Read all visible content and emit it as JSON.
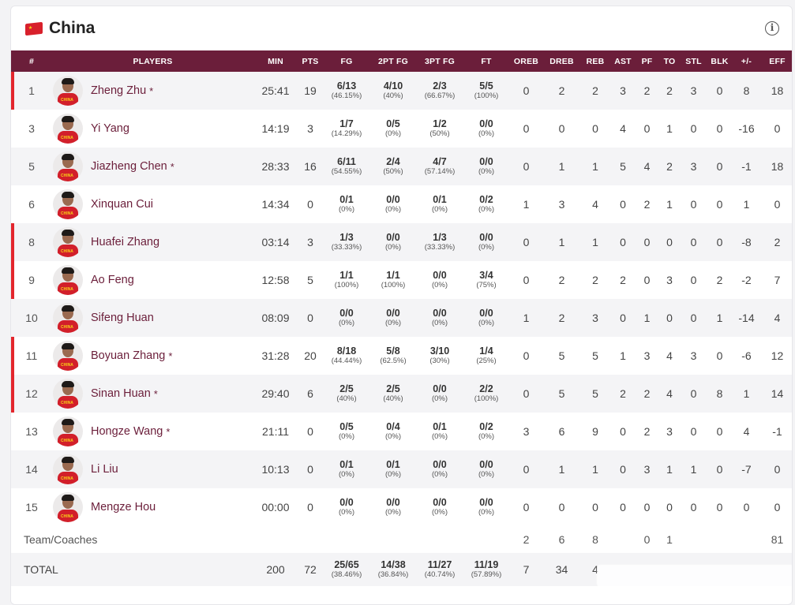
{
  "team": {
    "name": "China",
    "flag_icon": "china-flag-icon",
    "info_icon": "info-icon"
  },
  "colors": {
    "header_bg": "#6b1e3a",
    "starter_marker": "#e3262d",
    "player_name": "#6b1e3a"
  },
  "columns": [
    "#",
    "PLAYERS",
    "MIN",
    "PTS",
    "FG",
    "2PT FG",
    "3PT FG",
    "FT",
    "OREB",
    "DREB",
    "REB",
    "AST",
    "PF",
    "TO",
    "STL",
    "BLK",
    "+/-",
    "EFF"
  ],
  "players": [
    {
      "num": "1",
      "name": "Zheng Zhu",
      "star": "*",
      "starter": true,
      "min": "25:41",
      "pts": "19",
      "fg": "6/13",
      "fg_pct": "(46.15%)",
      "fg2": "4/10",
      "fg2_pct": "(40%)",
      "fg3": "2/3",
      "fg3_pct": "(66.67%)",
      "ft": "5/5",
      "ft_pct": "(100%)",
      "oreb": "0",
      "dreb": "2",
      "reb": "2",
      "ast": "3",
      "pf": "2",
      "to": "2",
      "stl": "3",
      "blk": "0",
      "pm": "8",
      "eff": "18"
    },
    {
      "num": "3",
      "name": "Yi Yang",
      "star": "",
      "starter": false,
      "min": "14:19",
      "pts": "3",
      "fg": "1/7",
      "fg_pct": "(14.29%)",
      "fg2": "0/5",
      "fg2_pct": "(0%)",
      "fg3": "1/2",
      "fg3_pct": "(50%)",
      "ft": "0/0",
      "ft_pct": "(0%)",
      "oreb": "0",
      "dreb": "0",
      "reb": "0",
      "ast": "4",
      "pf": "0",
      "to": "1",
      "stl": "0",
      "blk": "0",
      "pm": "-16",
      "eff": "0"
    },
    {
      "num": "5",
      "name": "Jiazheng Chen",
      "star": "*",
      "starter": false,
      "min": "28:33",
      "pts": "16",
      "fg": "6/11",
      "fg_pct": "(54.55%)",
      "fg2": "2/4",
      "fg2_pct": "(50%)",
      "fg3": "4/7",
      "fg3_pct": "(57.14%)",
      "ft": "0/0",
      "ft_pct": "(0%)",
      "oreb": "0",
      "dreb": "1",
      "reb": "1",
      "ast": "5",
      "pf": "4",
      "to": "2",
      "stl": "3",
      "blk": "0",
      "pm": "-1",
      "eff": "18"
    },
    {
      "num": "6",
      "name": "Xinquan Cui",
      "star": "",
      "starter": false,
      "min": "14:34",
      "pts": "0",
      "fg": "0/1",
      "fg_pct": "(0%)",
      "fg2": "0/0",
      "fg2_pct": "(0%)",
      "fg3": "0/1",
      "fg3_pct": "(0%)",
      "ft": "0/2",
      "ft_pct": "(0%)",
      "oreb": "1",
      "dreb": "3",
      "reb": "4",
      "ast": "0",
      "pf": "2",
      "to": "1",
      "stl": "0",
      "blk": "0",
      "pm": "1",
      "eff": "0"
    },
    {
      "num": "8",
      "name": "Huafei Zhang",
      "star": "",
      "starter": true,
      "min": "03:14",
      "pts": "3",
      "fg": "1/3",
      "fg_pct": "(33.33%)",
      "fg2": "0/0",
      "fg2_pct": "(0%)",
      "fg3": "1/3",
      "fg3_pct": "(33.33%)",
      "ft": "0/0",
      "ft_pct": "(0%)",
      "oreb": "0",
      "dreb": "1",
      "reb": "1",
      "ast": "0",
      "pf": "0",
      "to": "0",
      "stl": "0",
      "blk": "0",
      "pm": "-8",
      "eff": "2"
    },
    {
      "num": "9",
      "name": "Ao Feng",
      "star": "",
      "starter": true,
      "min": "12:58",
      "pts": "5",
      "fg": "1/1",
      "fg_pct": "(100%)",
      "fg2": "1/1",
      "fg2_pct": "(100%)",
      "fg3": "0/0",
      "fg3_pct": "(0%)",
      "ft": "3/4",
      "ft_pct": "(75%)",
      "oreb": "0",
      "dreb": "2",
      "reb": "2",
      "ast": "2",
      "pf": "0",
      "to": "3",
      "stl": "0",
      "blk": "2",
      "pm": "-2",
      "eff": "7"
    },
    {
      "num": "10",
      "name": "Sifeng Huan",
      "star": "",
      "starter": false,
      "min": "08:09",
      "pts": "0",
      "fg": "0/0",
      "fg_pct": "(0%)",
      "fg2": "0/0",
      "fg2_pct": "(0%)",
      "fg3": "0/0",
      "fg3_pct": "(0%)",
      "ft": "0/0",
      "ft_pct": "(0%)",
      "oreb": "1",
      "dreb": "2",
      "reb": "3",
      "ast": "0",
      "pf": "1",
      "to": "0",
      "stl": "0",
      "blk": "1",
      "pm": "-14",
      "eff": "4"
    },
    {
      "num": "11",
      "name": "Boyuan Zhang",
      "star": "*",
      "starter": true,
      "min": "31:28",
      "pts": "20",
      "fg": "8/18",
      "fg_pct": "(44.44%)",
      "fg2": "5/8",
      "fg2_pct": "(62.5%)",
      "fg3": "3/10",
      "fg3_pct": "(30%)",
      "ft": "1/4",
      "ft_pct": "(25%)",
      "oreb": "0",
      "dreb": "5",
      "reb": "5",
      "ast": "1",
      "pf": "3",
      "to": "4",
      "stl": "3",
      "blk": "0",
      "pm": "-6",
      "eff": "12"
    },
    {
      "num": "12",
      "name": "Sinan Huan",
      "star": "*",
      "starter": true,
      "min": "29:40",
      "pts": "6",
      "fg": "2/5",
      "fg_pct": "(40%)",
      "fg2": "2/5",
      "fg2_pct": "(40%)",
      "fg3": "0/0",
      "fg3_pct": "(0%)",
      "ft": "2/2",
      "ft_pct": "(100%)",
      "oreb": "0",
      "dreb": "5",
      "reb": "5",
      "ast": "2",
      "pf": "2",
      "to": "4",
      "stl": "0",
      "blk": "8",
      "pm": "1",
      "eff": "14"
    },
    {
      "num": "13",
      "name": "Hongze Wang",
      "star": "*",
      "starter": false,
      "min": "21:11",
      "pts": "0",
      "fg": "0/5",
      "fg_pct": "(0%)",
      "fg2": "0/4",
      "fg2_pct": "(0%)",
      "fg3": "0/1",
      "fg3_pct": "(0%)",
      "ft": "0/2",
      "ft_pct": "(0%)",
      "oreb": "3",
      "dreb": "6",
      "reb": "9",
      "ast": "0",
      "pf": "2",
      "to": "3",
      "stl": "0",
      "blk": "0",
      "pm": "4",
      "eff": "-1"
    },
    {
      "num": "14",
      "name": "Li Liu",
      "star": "",
      "starter": false,
      "min": "10:13",
      "pts": "0",
      "fg": "0/1",
      "fg_pct": "(0%)",
      "fg2": "0/1",
      "fg2_pct": "(0%)",
      "fg3": "0/0",
      "fg3_pct": "(0%)",
      "ft": "0/0",
      "ft_pct": "(0%)",
      "oreb": "0",
      "dreb": "1",
      "reb": "1",
      "ast": "0",
      "pf": "3",
      "to": "1",
      "stl": "1",
      "blk": "0",
      "pm": "-7",
      "eff": "0"
    },
    {
      "num": "15",
      "name": "Mengze Hou",
      "star": "",
      "starter": false,
      "min": "00:00",
      "pts": "0",
      "fg": "0/0",
      "fg_pct": "(0%)",
      "fg2": "0/0",
      "fg2_pct": "(0%)",
      "fg3": "0/0",
      "fg3_pct": "(0%)",
      "ft": "0/0",
      "ft_pct": "(0%)",
      "oreb": "0",
      "dreb": "0",
      "reb": "0",
      "ast": "0",
      "pf": "0",
      "to": "0",
      "stl": "0",
      "blk": "0",
      "pm": "0",
      "eff": "0"
    }
  ],
  "team_row": {
    "label": "Team/Coaches",
    "oreb": "2",
    "dreb": "6",
    "reb": "8",
    "pf": "0",
    "to": "1",
    "eff": "81"
  },
  "total_row": {
    "label": "TOTAL",
    "min": "200",
    "pts": "72",
    "fg": "25/65",
    "fg_pct": "(38.46%)",
    "fg2": "14/38",
    "fg2_pct": "(36.84%)",
    "fg3": "11/27",
    "fg3_pct": "(40.74%)",
    "ft": "11/19",
    "ft_pct": "(57.89%)",
    "oreb": "7",
    "dreb": "34",
    "reb": "4"
  }
}
